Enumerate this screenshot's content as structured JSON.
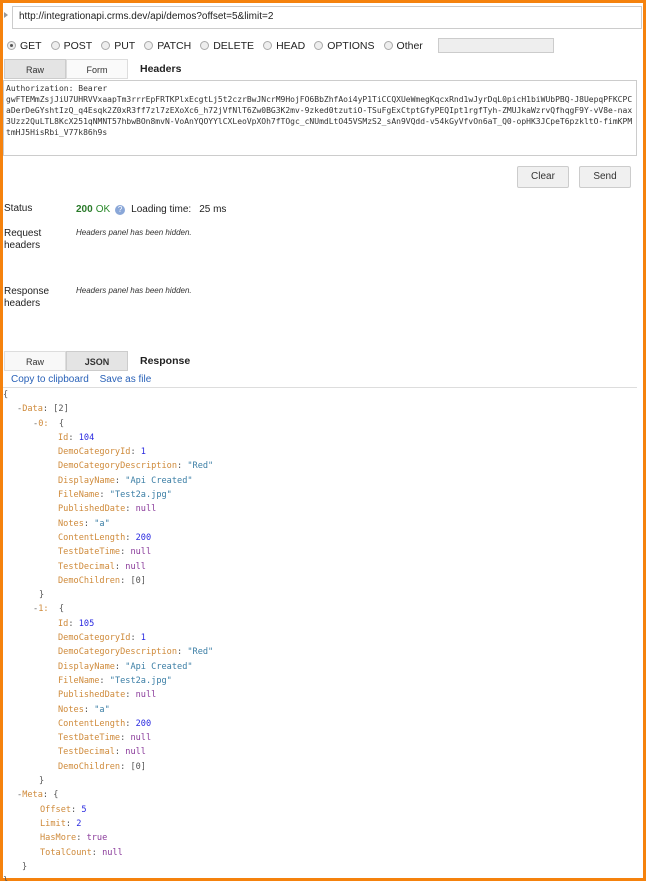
{
  "url": "http://integrationapi.crms.dev/api/demos?offset=5&limit=2",
  "methods": [
    {
      "label": "GET",
      "selected": true
    },
    {
      "label": "POST",
      "selected": false
    },
    {
      "label": "PUT",
      "selected": false
    },
    {
      "label": "PATCH",
      "selected": false
    },
    {
      "label": "DELETE",
      "selected": false
    },
    {
      "label": "HEAD",
      "selected": false
    },
    {
      "label": "OPTIONS",
      "selected": false
    },
    {
      "label": "Other",
      "selected": false
    }
  ],
  "other_method_value": "",
  "request_tabs": {
    "raw": "Raw",
    "form": "Form",
    "title": "Headers",
    "selected": "Raw"
  },
  "headers_text": "Authorization: Bearer\ngwFTEMmZsjJiU7UHRVVxaapTm3rrrEpFRTKPlxEcgtLj5t2czrBwJNcrM9HojFO6BbZhfAoi4yP1TiCCQXUeWmegKqcxRnd1wJyrDqL0picH1biWUbPBQ-J8UepqPFKCPCaDerDeGYshtIzQ_q4Esqk2Z0xR3ff7zl7zEXoXc6_h72jVfNlT6Zw0BG3K2mv-9zked0tzutiO-TSuFgExCtptGfyPEQIpt1rgfTyh-ZMUJkaWzrvQfhqgF9Y-vV8e-nax3Uzz2QuLTL8KcX251qNMNT57hbwBOn8mvN-VoAnYQOYYlCXLeoVpXOh7fTOgc_cNUmdLtO45VSMzS2_sAn9VQdd-v54kGyVfvOn6aT_Q0-opHK3JCpeT6pzkltO-fimKPMtmHJ5HisRbi_V77k86h9s",
  "buttons": {
    "clear": "Clear",
    "send": "Send"
  },
  "status": {
    "label": "Status",
    "code": "200",
    "text": "OK",
    "loading_label": "Loading time:",
    "loading_value": "25 ms"
  },
  "request_headers": {
    "label_line1": "Request",
    "label_line2": "headers",
    "message": "Headers panel has been hidden."
  },
  "response_headers": {
    "label_line1": "Response",
    "label_line2": "headers",
    "message": "Headers panel has been hidden."
  },
  "response_tabs": {
    "raw": "Raw",
    "json": "JSON",
    "title": "Response",
    "selected": "JSON"
  },
  "response_links": {
    "copy": "Copy to clipboard",
    "save": "Save as file"
  },
  "colors": {
    "border": "#f5820d",
    "key": "#cf8a3a",
    "string": "#3b7ea5",
    "number": "#2a2ae0",
    "literal": "#8a3a9a",
    "link": "#2a62b8",
    "status_ok": "#2a8a2a"
  },
  "response_json": {
    "Data": [
      {
        "Id": 104,
        "DemoCategoryId": 1,
        "DemoCategoryDescription": "Red",
        "DisplayName": "Api Created",
        "FileName": "Test2a.jpg",
        "PublishedDate": null,
        "Notes": "a",
        "ContentLength": 200,
        "TestDateTime": null,
        "TestDecimal": null,
        "DemoChildren": []
      },
      {
        "Id": 105,
        "DemoCategoryId": 1,
        "DemoCategoryDescription": "Red",
        "DisplayName": "Api Created",
        "FileName": "Test2a.jpg",
        "PublishedDate": null,
        "Notes": "a",
        "ContentLength": 200,
        "TestDateTime": null,
        "TestDecimal": null,
        "DemoChildren": []
      }
    ],
    "Meta": {
      "Offset": 5,
      "Limit": 2,
      "HasMore": true,
      "TotalCount": null
    }
  }
}
